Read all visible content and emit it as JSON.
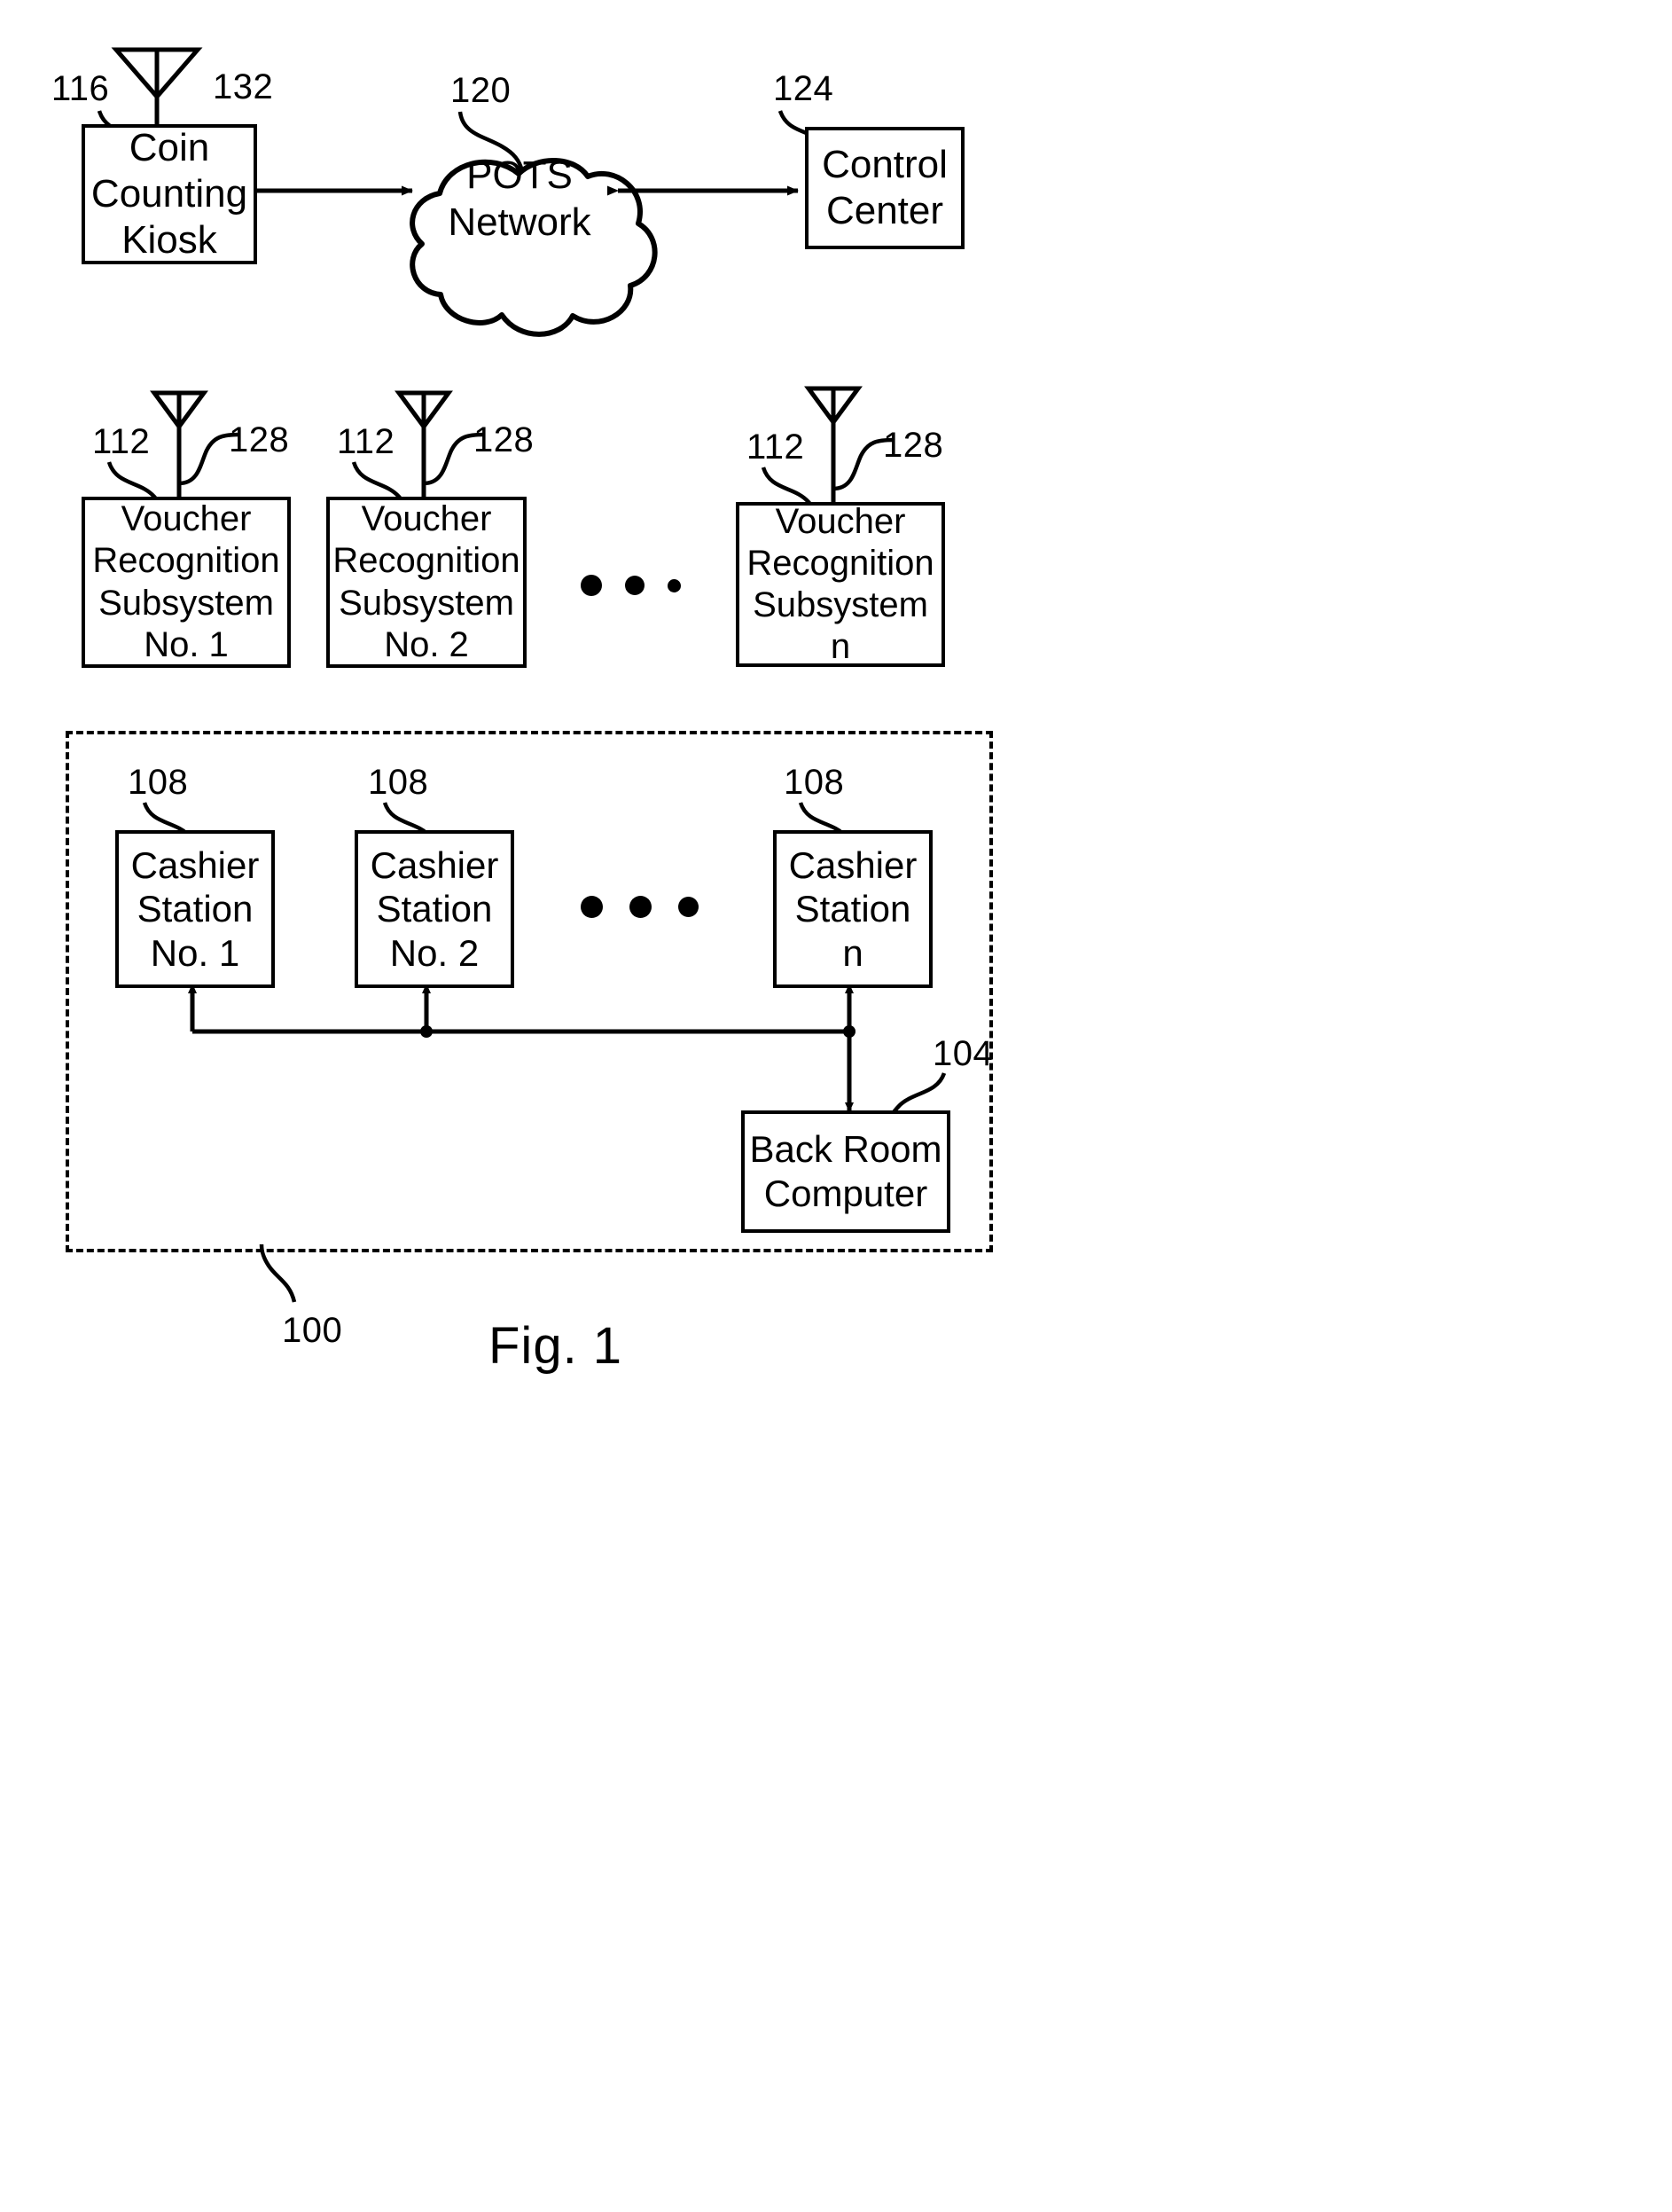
{
  "figure": {
    "caption": "Fig. 1",
    "system_ref": "100"
  },
  "top_row": {
    "kiosk": {
      "label": "Coin\nCounting\nKiosk",
      "ref": "116",
      "antenna_ref": "132",
      "antenna_icon": "antenna-icon"
    },
    "network": {
      "label": "POTS\nNetwork",
      "ref": "120",
      "shape": "cloud"
    },
    "control_center": {
      "label": "Control\nCenter",
      "ref": "124"
    },
    "link_left_arrow": "double-arrow",
    "link_right_arrow": "double-arrow"
  },
  "voucher_row": {
    "ref": "112",
    "antenna_ref": "128",
    "antenna_icon": "antenna-icon",
    "ellipsis": "• • •",
    "items": [
      {
        "label": "Voucher\nRecognition\nSubsystem\nNo. 1"
      },
      {
        "label": "Voucher\nRecognition\nSubsystem\nNo. 2"
      },
      {
        "label": "Voucher\nRecognition\nSubsystem\nn"
      }
    ]
  },
  "store_zone": {
    "ref": "100",
    "cashier_ref": "108",
    "ellipsis": "• • •",
    "cashiers": [
      {
        "label": "Cashier\nStation\nNo. 1"
      },
      {
        "label": "Cashier\nStation\nNo. 2"
      },
      {
        "label": "Cashier\nStation\nn"
      }
    ],
    "back_room": {
      "label": "Back Room\nComputer",
      "ref": "104"
    }
  },
  "colors": {
    "ink": "#000000",
    "paper": "#ffffff"
  }
}
